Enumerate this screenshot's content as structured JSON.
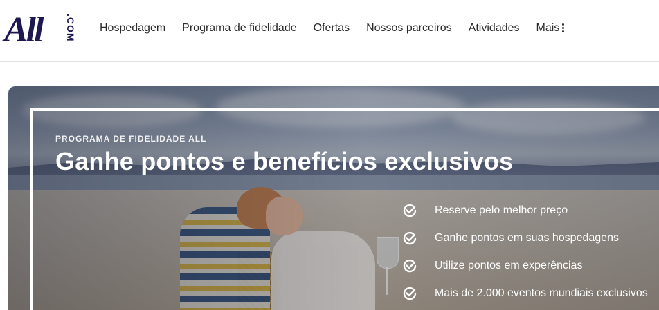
{
  "logo": {
    "main": "All",
    "suffix": ".COM"
  },
  "nav": {
    "items": [
      {
        "label": "Hospedagem"
      },
      {
        "label": "Programa de fidelidade"
      },
      {
        "label": "Ofertas"
      },
      {
        "label": "Nossos parceiros"
      },
      {
        "label": "Atividades"
      }
    ],
    "more_label": "Mais"
  },
  "hero": {
    "eyebrow": "PROGRAMA DE FIDELIDADE ALL",
    "headline": "Ganhe pontos e benefícios exclusivos",
    "benefits": [
      {
        "label": "Reserve pelo melhor preço",
        "icon": "check-circle-icon"
      },
      {
        "label": "Ganhe pontos em suas hospedagens",
        "icon": "check-circle-icon"
      },
      {
        "label": "Utilize pontos em experências",
        "icon": "check-circle-icon"
      },
      {
        "label": "Mais de 2.000 eventos mundiais exclusivos",
        "icon": "check-circle-icon"
      }
    ]
  },
  "colors": {
    "brand": "#1e1852",
    "text": "#2a2a2a",
    "hero_text": "#ffffff"
  }
}
